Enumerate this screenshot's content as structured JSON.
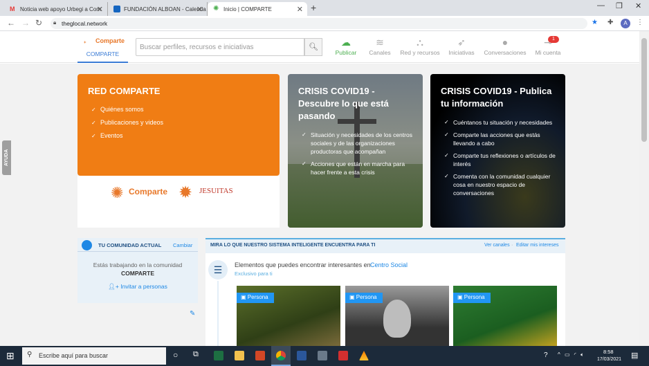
{
  "browser": {
    "tabs": [
      {
        "title": "Noticia web apoyo Urbegi a Com",
        "color": "#e53935"
      },
      {
        "title": "FUNDACIÓN ALBOAN - Calenda",
        "color": "#1565c0"
      },
      {
        "title": "Inicio | COMPARTE",
        "color": "#4caf50"
      }
    ],
    "url": "theglocal.network",
    "profile_initial": "A"
  },
  "header": {
    "brand": "Comparte",
    "brand_tab": "COMPARTE",
    "search_placeholder": "Buscar perfiles, recursos e iniciativas",
    "menu": [
      {
        "label": "Publicar",
        "icon": "cloud-upload-icon"
      },
      {
        "label": "Canales",
        "icon": "layers-icon"
      },
      {
        "label": "Red y recursos",
        "icon": "network-icon"
      },
      {
        "label": "Iniciativas",
        "icon": "rocket-icon"
      },
      {
        "label": "Conversaciones",
        "icon": "chat-icon"
      },
      {
        "label": "Mi cuenta",
        "icon": "account-icon"
      }
    ],
    "notification_count": "1"
  },
  "help_label": "AYUDA",
  "red_comparte": {
    "title": "RED COMPARTE",
    "items": [
      "Quiénes somos",
      "Publicaciones y videos",
      "Eventos"
    ],
    "logos": [
      "Comparte",
      "JESUITAS"
    ]
  },
  "covid_descubre": {
    "title": "CRISIS COVID19 - Descubre lo que está pasando",
    "items": [
      "Situación y necesidades de los centros sociales y de las organizaciones productoras que acompañan",
      "Acciones que están en marcha para hacer frente a esta crisis"
    ]
  },
  "covid_publica": {
    "title": "CRISIS COVID19 - Publica tu información",
    "items": [
      "Cuéntanos tu situación y necesidades",
      "Comparte las acciones que estás llevando a cabo",
      "Comparte tus reflexiones o artículos de interés",
      "Comenta con la comunidad cualquier cosa en nuestro espacio de conversaciones"
    ]
  },
  "community": {
    "header": "TU COMUNIDAD ACTUAL",
    "change": "Cambiar",
    "working_text": "Estás trabajando en la comunidad",
    "name": "COMPARTE",
    "invite": "Invitar a personas"
  },
  "recommendations": {
    "header": "MIRA LO QUE NUESTRO SISTEMA INTELIGENTE ENCUENTRA PARA TI",
    "see_channels": "Ver canales",
    "edit_interests": "Editar mis intereses",
    "intro": "Elementos que puedes encontrar interesantes en",
    "center": "Centro Social",
    "exclusive": "Exclusivo para ti",
    "cards": [
      {
        "tag": "Persona"
      },
      {
        "tag": "Persona"
      },
      {
        "tag": "Persona"
      }
    ]
  },
  "taskbar": {
    "search": "Escribe aquí para buscar",
    "time": "8:58",
    "date": "17/03/2021"
  }
}
